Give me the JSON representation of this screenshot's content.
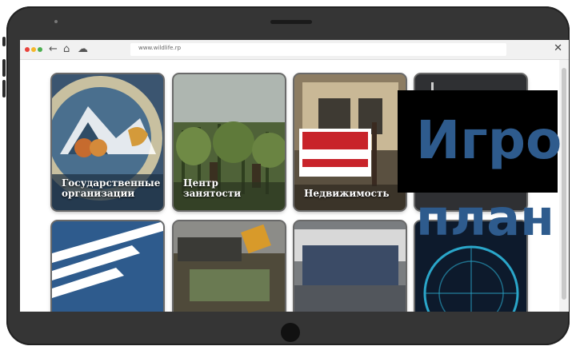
{
  "browser": {
    "url": "www.wildlife.rp",
    "traffic_lights": [
      "#e8423b",
      "#f5b72a",
      "#4caf50"
    ],
    "back_icon": "←",
    "home_icon": "⌂",
    "chat_icon": "☁",
    "close_icon": "✕"
  },
  "tiles": [
    {
      "label": "Государственные организации",
      "icon": "county-seal"
    },
    {
      "label": "Центр занятости",
      "icon": "vineyard-workers"
    },
    {
      "label": "Недвижимость",
      "icon": "foreclosure-sign"
    },
    {
      "label": "",
      "icon": "dark-tile"
    },
    {
      "label": "",
      "icon": "blue-stripes-logo"
    },
    {
      "label": "",
      "icon": "bus-stop"
    },
    {
      "label": "",
      "icon": "bus-interior"
    },
    {
      "label": "",
      "icon": "network-globe"
    }
  ],
  "overlay": {
    "title": "Игро",
    "subtitle": "план",
    "color": "#2e5b8d"
  }
}
